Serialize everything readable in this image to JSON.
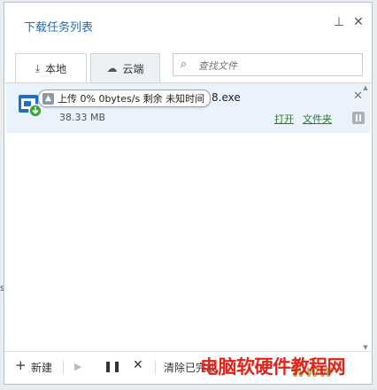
{
  "window": {
    "title": "下载任务列表"
  },
  "titlebar": {
    "pin_icon": "pin-icon",
    "close_icon": "close-icon"
  },
  "tabs": [
    {
      "label": "本地",
      "icon": "download-tray-icon",
      "active": true
    },
    {
      "label": "云端",
      "icon": "cloud-icon",
      "active": false
    }
  ],
  "search": {
    "placeholder": "查找文件",
    "icon": "search-icon"
  },
  "tasks": [
    {
      "name_visible": "8.exe",
      "size": "38.33 MB",
      "status_tooltip": "上传 0% 0bytes/s 剩余 未知时间",
      "actions": {
        "open": "打开",
        "folder": "文件夹"
      },
      "file_icon": "installer-file-icon"
    }
  ],
  "bottombar": {
    "new_label": "新建",
    "clear_label": "清除已完成"
  },
  "watermark": {
    "text": "电脑软硬件教程网",
    "sub": "WWW"
  },
  "edge_char": "s",
  "colors": {
    "title": "#1f6fb8",
    "accent_green": "#2d7a2d",
    "row_bg": "#eaf2fb",
    "watermark": "#e2231a"
  }
}
